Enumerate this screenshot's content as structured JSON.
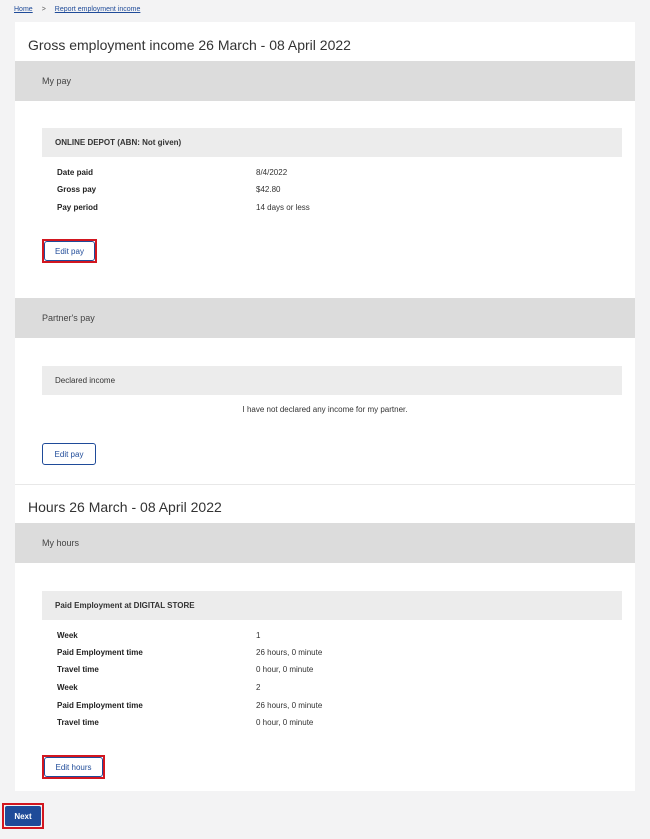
{
  "breadcrumb": {
    "home": "Home",
    "separator": ">",
    "current": "Report employment income"
  },
  "gross": {
    "title": "Gross employment income 26 March - 08 April 2022",
    "my_pay": {
      "band": "My pay",
      "employer": "ONLINE DEPOT (ABN: Not given)",
      "rows": [
        {
          "label": "Date paid",
          "value": "8/4/2022"
        },
        {
          "label": "Gross pay",
          "value": "$42.80"
        },
        {
          "label": "Pay period",
          "value": "14 days or less"
        }
      ],
      "edit_label": "Edit pay"
    },
    "partner_pay": {
      "band": "Partner's pay",
      "subhead": "Declared income",
      "note": "I have not declared any income for my partner.",
      "edit_label": "Edit pay"
    }
  },
  "hours": {
    "title": "Hours 26 March - 08 April 2022",
    "band": "My hours",
    "employer": "Paid Employment at DIGITAL STORE",
    "rows": [
      {
        "label": "Week",
        "value": "1"
      },
      {
        "label": "Paid Employment time",
        "value": "26 hours, 0 minute"
      },
      {
        "label": "Travel time",
        "value": "0 hour, 0 minute"
      },
      {
        "label": "Week",
        "value": "2"
      },
      {
        "label": "Paid Employment time",
        "value": "26 hours, 0 minute"
      },
      {
        "label": "Travel time",
        "value": "0 hour, 0 minute"
      }
    ],
    "edit_label": "Edit hours"
  },
  "footer": {
    "next_label": "Next"
  },
  "colors": {
    "primary": "#1f4b99",
    "highlight": "#d2161f",
    "band": "#dcdcdc"
  }
}
